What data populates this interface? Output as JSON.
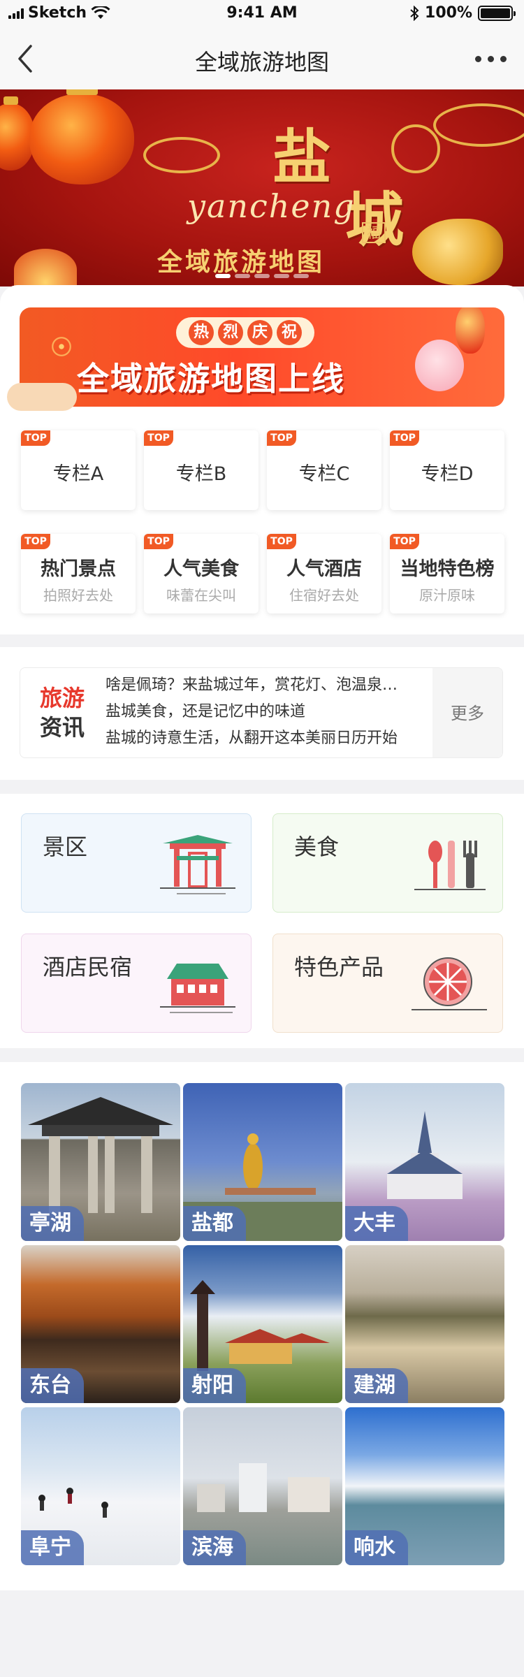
{
  "status_bar": {
    "carrier": "Sketch",
    "time": "9:41 AM",
    "battery": "100%"
  },
  "nav": {
    "title": "全域旅游地图"
  },
  "banner": {
    "title_char_1": "盐",
    "title_char_2": "城",
    "script_text": "yancheng",
    "subtitle": "全域旅游地图",
    "fu_char": "福",
    "slide_count": 5,
    "active_slide": 1
  },
  "promo": {
    "pill_chars": [
      "热",
      "烈",
      "庆",
      "祝"
    ],
    "title": "全域旅游地图上线"
  },
  "columns": {
    "badge": "TOP",
    "row1": [
      {
        "label": "专栏A"
      },
      {
        "label": "专栏B"
      },
      {
        "label": "专栏C"
      },
      {
        "label": "专栏D"
      }
    ],
    "row2": [
      {
        "label": "热门景点",
        "sub": "拍照好去处"
      },
      {
        "label": "人气美食",
        "sub": "味蕾在尖叫"
      },
      {
        "label": "人气酒店",
        "sub": "住宿好去处"
      },
      {
        "label": "当地特色榜",
        "sub": "原汁原味"
      }
    ]
  },
  "news": {
    "logo_line_1": "旅游",
    "logo_line_2": "资讯",
    "items": [
      "啥是佩琦？来盐城过年，赏花灯、泡温泉…",
      "盐城美食，还是记忆中的味道",
      "盐城的诗意生活，从翻开这本美丽日历开始"
    ],
    "more_label": "更多"
  },
  "categories": [
    {
      "label": "景区",
      "icon": "archway-icon",
      "bg": "#f1f7fd"
    },
    {
      "label": "美食",
      "icon": "cutlery-icon",
      "bg": "#f5fbf2"
    },
    {
      "label": "酒店民宿",
      "icon": "hotel-icon",
      "bg": "#fcf4fb"
    },
    {
      "label": "特色产品",
      "icon": "grapefruit-icon",
      "bg": "#fdf6ef"
    }
  ],
  "regions": [
    {
      "name": "亭湖"
    },
    {
      "name": "盐都"
    },
    {
      "name": "大丰"
    },
    {
      "name": "东台"
    },
    {
      "name": "射阳"
    },
    {
      "name": "建湖"
    },
    {
      "name": "阜宁"
    },
    {
      "name": "滨海"
    },
    {
      "name": "响水"
    }
  ],
  "colors": {
    "accent": "#f15a25",
    "region_tag": "#506eb4",
    "banner_red": "#a5140f"
  }
}
